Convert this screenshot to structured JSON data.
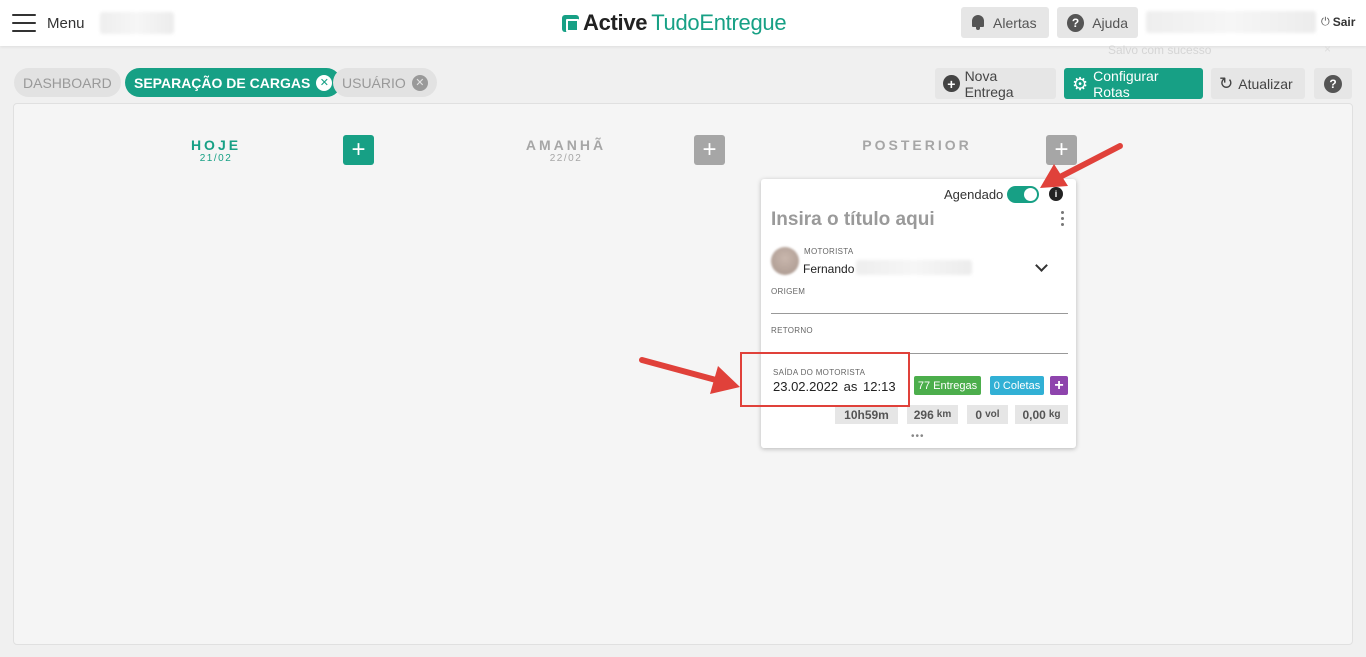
{
  "topbar": {
    "menu_label": "Menu",
    "logo_bold": "Active",
    "logo_rest": "TudoEntregue",
    "alerts_label": "Alertas",
    "help_label": "Ajuda",
    "help_icon": "?",
    "logout_label": "Sair",
    "toast_text": "Salvo com sucesso",
    "toast_close": "×"
  },
  "tabs": [
    {
      "label": "DASHBOARD",
      "active": false
    },
    {
      "label": "SEPARAÇÃO DE CARGAS",
      "active": true
    },
    {
      "label": "USUÁRIO",
      "active": false
    }
  ],
  "tab_close_glyph": "✕",
  "actions": {
    "new_delivery": "Nova Entrega",
    "configure_routes": "Configurar Rotas",
    "refresh": "Atualizar",
    "help_icon": "?"
  },
  "columns": [
    {
      "title": "HOJE",
      "date": "21/02",
      "color": "#17a085"
    },
    {
      "title": "AMANHÃ",
      "date": "22/02",
      "color": "#a6a6a6"
    },
    {
      "title": "POSTERIOR",
      "date": "",
      "color": "#a6a6a6"
    }
  ],
  "add_glyph": "+",
  "card": {
    "scheduled_label": "Agendado",
    "scheduled_on": true,
    "info_icon": "i",
    "title_placeholder": "Insira o título aqui",
    "driver_label": "MOTORISTA",
    "driver_name": "Fernando",
    "origin_label": "ORIGEM",
    "return_label": "RETORNO",
    "departure_label": "SAÍDA DO MOTORISTA",
    "departure_value": "23.02.2022  as  12:13",
    "deliveries_badge": "77 Entregas",
    "pickups_badge": "0 Coletas",
    "add_glyph": "+",
    "stats": {
      "duration": "10h59m",
      "distance": "296",
      "distance_unit": "km",
      "volume": "0",
      "volume_unit": "vol",
      "weight": "0,00",
      "weight_unit": "kg"
    },
    "more": "•••"
  },
  "colors": {
    "brand": "#17a085",
    "deliveries": "#4cae4c",
    "pickups": "#31b0d5",
    "add_purple": "#8e44ad",
    "annotation": "#e0413a"
  }
}
